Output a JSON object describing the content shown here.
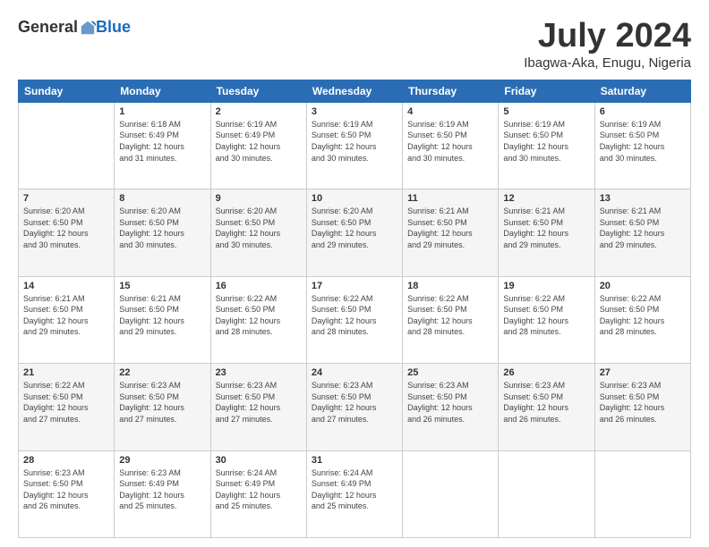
{
  "header": {
    "logo_general": "General",
    "logo_blue": "Blue",
    "month_title": "July 2024",
    "location": "Ibagwa-Aka, Enugu, Nigeria"
  },
  "days_of_week": [
    "Sunday",
    "Monday",
    "Tuesday",
    "Wednesday",
    "Thursday",
    "Friday",
    "Saturday"
  ],
  "weeks": [
    {
      "days": [
        {
          "number": "",
          "info": ""
        },
        {
          "number": "1",
          "info": "Sunrise: 6:18 AM\nSunset: 6:49 PM\nDaylight: 12 hours\nand 31 minutes."
        },
        {
          "number": "2",
          "info": "Sunrise: 6:19 AM\nSunset: 6:49 PM\nDaylight: 12 hours\nand 30 minutes."
        },
        {
          "number": "3",
          "info": "Sunrise: 6:19 AM\nSunset: 6:50 PM\nDaylight: 12 hours\nand 30 minutes."
        },
        {
          "number": "4",
          "info": "Sunrise: 6:19 AM\nSunset: 6:50 PM\nDaylight: 12 hours\nand 30 minutes."
        },
        {
          "number": "5",
          "info": "Sunrise: 6:19 AM\nSunset: 6:50 PM\nDaylight: 12 hours\nand 30 minutes."
        },
        {
          "number": "6",
          "info": "Sunrise: 6:19 AM\nSunset: 6:50 PM\nDaylight: 12 hours\nand 30 minutes."
        }
      ]
    },
    {
      "days": [
        {
          "number": "7",
          "info": "Sunrise: 6:20 AM\nSunset: 6:50 PM\nDaylight: 12 hours\nand 30 minutes."
        },
        {
          "number": "8",
          "info": "Sunrise: 6:20 AM\nSunset: 6:50 PM\nDaylight: 12 hours\nand 30 minutes."
        },
        {
          "number": "9",
          "info": "Sunrise: 6:20 AM\nSunset: 6:50 PM\nDaylight: 12 hours\nand 30 minutes."
        },
        {
          "number": "10",
          "info": "Sunrise: 6:20 AM\nSunset: 6:50 PM\nDaylight: 12 hours\nand 29 minutes."
        },
        {
          "number": "11",
          "info": "Sunrise: 6:21 AM\nSunset: 6:50 PM\nDaylight: 12 hours\nand 29 minutes."
        },
        {
          "number": "12",
          "info": "Sunrise: 6:21 AM\nSunset: 6:50 PM\nDaylight: 12 hours\nand 29 minutes."
        },
        {
          "number": "13",
          "info": "Sunrise: 6:21 AM\nSunset: 6:50 PM\nDaylight: 12 hours\nand 29 minutes."
        }
      ]
    },
    {
      "days": [
        {
          "number": "14",
          "info": "Sunrise: 6:21 AM\nSunset: 6:50 PM\nDaylight: 12 hours\nand 29 minutes."
        },
        {
          "number": "15",
          "info": "Sunrise: 6:21 AM\nSunset: 6:50 PM\nDaylight: 12 hours\nand 29 minutes."
        },
        {
          "number": "16",
          "info": "Sunrise: 6:22 AM\nSunset: 6:50 PM\nDaylight: 12 hours\nand 28 minutes."
        },
        {
          "number": "17",
          "info": "Sunrise: 6:22 AM\nSunset: 6:50 PM\nDaylight: 12 hours\nand 28 minutes."
        },
        {
          "number": "18",
          "info": "Sunrise: 6:22 AM\nSunset: 6:50 PM\nDaylight: 12 hours\nand 28 minutes."
        },
        {
          "number": "19",
          "info": "Sunrise: 6:22 AM\nSunset: 6:50 PM\nDaylight: 12 hours\nand 28 minutes."
        },
        {
          "number": "20",
          "info": "Sunrise: 6:22 AM\nSunset: 6:50 PM\nDaylight: 12 hours\nand 28 minutes."
        }
      ]
    },
    {
      "days": [
        {
          "number": "21",
          "info": "Sunrise: 6:22 AM\nSunset: 6:50 PM\nDaylight: 12 hours\nand 27 minutes."
        },
        {
          "number": "22",
          "info": "Sunrise: 6:23 AM\nSunset: 6:50 PM\nDaylight: 12 hours\nand 27 minutes."
        },
        {
          "number": "23",
          "info": "Sunrise: 6:23 AM\nSunset: 6:50 PM\nDaylight: 12 hours\nand 27 minutes."
        },
        {
          "number": "24",
          "info": "Sunrise: 6:23 AM\nSunset: 6:50 PM\nDaylight: 12 hours\nand 27 minutes."
        },
        {
          "number": "25",
          "info": "Sunrise: 6:23 AM\nSunset: 6:50 PM\nDaylight: 12 hours\nand 26 minutes."
        },
        {
          "number": "26",
          "info": "Sunrise: 6:23 AM\nSunset: 6:50 PM\nDaylight: 12 hours\nand 26 minutes."
        },
        {
          "number": "27",
          "info": "Sunrise: 6:23 AM\nSunset: 6:50 PM\nDaylight: 12 hours\nand 26 minutes."
        }
      ]
    },
    {
      "days": [
        {
          "number": "28",
          "info": "Sunrise: 6:23 AM\nSunset: 6:50 PM\nDaylight: 12 hours\nand 26 minutes."
        },
        {
          "number": "29",
          "info": "Sunrise: 6:23 AM\nSunset: 6:49 PM\nDaylight: 12 hours\nand 25 minutes."
        },
        {
          "number": "30",
          "info": "Sunrise: 6:24 AM\nSunset: 6:49 PM\nDaylight: 12 hours\nand 25 minutes."
        },
        {
          "number": "31",
          "info": "Sunrise: 6:24 AM\nSunset: 6:49 PM\nDaylight: 12 hours\nand 25 minutes."
        },
        {
          "number": "",
          "info": ""
        },
        {
          "number": "",
          "info": ""
        },
        {
          "number": "",
          "info": ""
        }
      ]
    }
  ]
}
